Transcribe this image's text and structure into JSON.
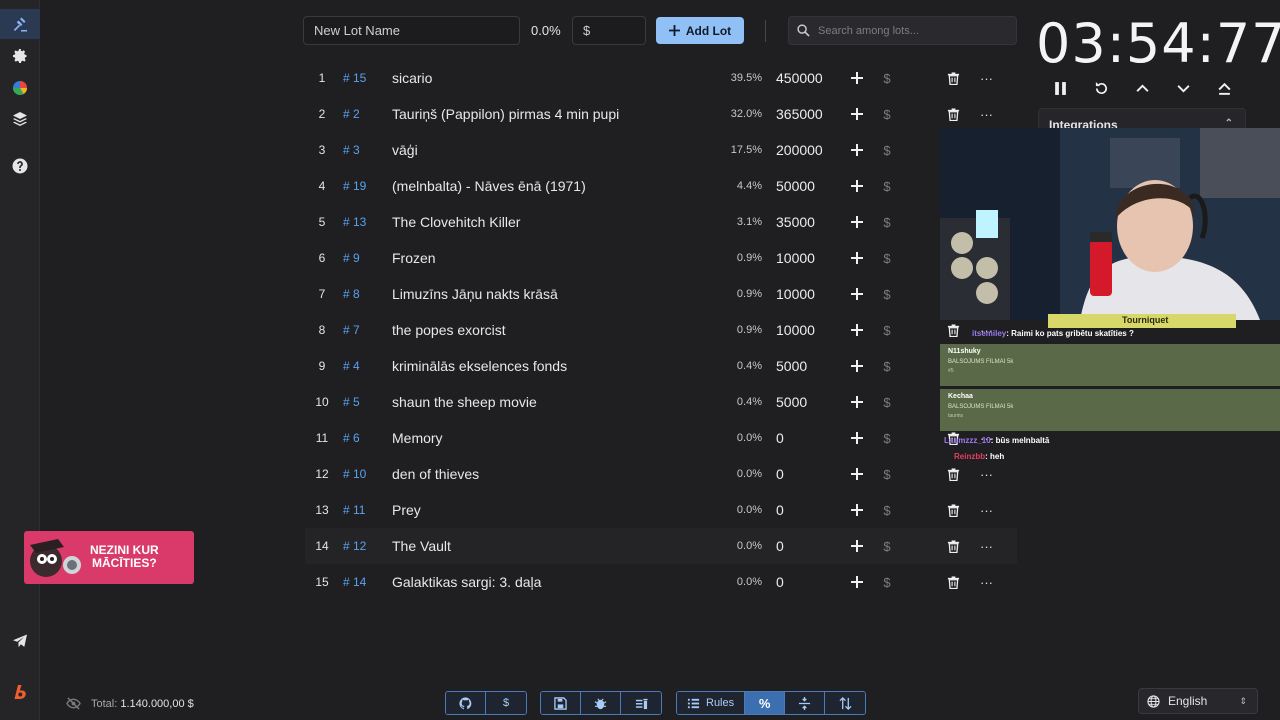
{
  "toolbar": {
    "lot_name_placeholder": "New Lot Name",
    "percent_label": "0.0%",
    "amount_placeholder": "$",
    "add_lot_label": "Add Lot",
    "search_placeholder": "Search among lots..."
  },
  "sidebar": {
    "items": [
      {
        "icon": "auction-gavel-icon",
        "active": true
      },
      {
        "icon": "gear-icon"
      },
      {
        "icon": "pie-chart-icon"
      },
      {
        "icon": "layers-icon"
      },
      {
        "icon": "help-icon"
      },
      {
        "icon": "telegram-icon"
      },
      {
        "icon": "boosty-icon"
      }
    ]
  },
  "lots": [
    {
      "rank": "1",
      "id": "# 15",
      "name": "sicario",
      "pct": "39.5%",
      "amount": "450000"
    },
    {
      "rank": "2",
      "id": "# 2",
      "name": "Tauriņš (Pappilon) pirmas 4 min pupi",
      "pct": "32.0%",
      "amount": "365000"
    },
    {
      "rank": "3",
      "id": "# 3",
      "name": "vāģi",
      "pct": "17.5%",
      "amount": "200000"
    },
    {
      "rank": "4",
      "id": "# 19",
      "name": "(melnbalta) - Nāves ēnā (1971)",
      "pct": "4.4%",
      "amount": "50000"
    },
    {
      "rank": "5",
      "id": "# 13",
      "name": "The Clovehitch Killer",
      "pct": "3.1%",
      "amount": "35000"
    },
    {
      "rank": "6",
      "id": "# 9",
      "name": "Frozen",
      "pct": "0.9%",
      "amount": "10000"
    },
    {
      "rank": "7",
      "id": "# 8",
      "name": "Limuzīns Jāņu nakts krāsā",
      "pct": "0.9%",
      "amount": "10000"
    },
    {
      "rank": "8",
      "id": "# 7",
      "name": "the popes exorcist",
      "pct": "0.9%",
      "amount": "10000"
    },
    {
      "rank": "9",
      "id": "# 4",
      "name": "kriminālās ekselences fonds",
      "pct": "0.4%",
      "amount": "5000"
    },
    {
      "rank": "10",
      "id": "# 5",
      "name": "shaun the sheep movie",
      "pct": "0.4%",
      "amount": "5000"
    },
    {
      "rank": "11",
      "id": "# 6",
      "name": "Memory",
      "pct": "0.0%",
      "amount": "0"
    },
    {
      "rank": "12",
      "id": "# 10",
      "name": "den of thieves",
      "pct": "0.0%",
      "amount": "0"
    },
    {
      "rank": "13",
      "id": "# 11",
      "name": "Prey",
      "pct": "0.0%",
      "amount": "0"
    },
    {
      "rank": "14",
      "id": "# 12",
      "name": "The Vault",
      "pct": "0.0%",
      "amount": "0"
    },
    {
      "rank": "15",
      "id": "# 14",
      "name": "Galaktikas sargi: 3. daļa",
      "pct": "0.0%",
      "amount": "0"
    }
  ],
  "row_actions": {
    "add_symbol": "+",
    "dollar_symbol": "$",
    "more_symbol": "···"
  },
  "timer": {
    "display": "03:54:77"
  },
  "integrations": {
    "title": "Integrations"
  },
  "chat": {
    "line1_user": "itsemiley",
    "line1_text": ": Raimi ko pats gribētu skatīties ?",
    "card1_user": "N11shuky",
    "card1_text": "BALSOJUMS FILMAI 5k",
    "card1_sub": "#5",
    "card2_user": "Kechaa",
    "card2_text": "BALSOJUMS FILMAI 5k",
    "card2_sub": "taurins",
    "line2_user": "Laumzzz_10",
    "line2_text": ": būs melnbaltā",
    "line3_user": "Reinzbb",
    "line3_text": ": heh",
    "banner_text": "Tourniquet"
  },
  "promo": {
    "line1": "NEZINI KUR",
    "line2": "MĀCĪTIES?"
  },
  "footer": {
    "total_label": "Total:",
    "total_value": "1.140.000,00 $",
    "rules_label": "Rules",
    "percent_symbol": "%",
    "dollar_symbol": "$"
  },
  "language": {
    "selected": "English"
  },
  "colors": {
    "accent": "#90c0f5",
    "id_blue": "#5aa0ef",
    "background": "#1f1f22",
    "sidebar_active": "#2b3a52"
  }
}
